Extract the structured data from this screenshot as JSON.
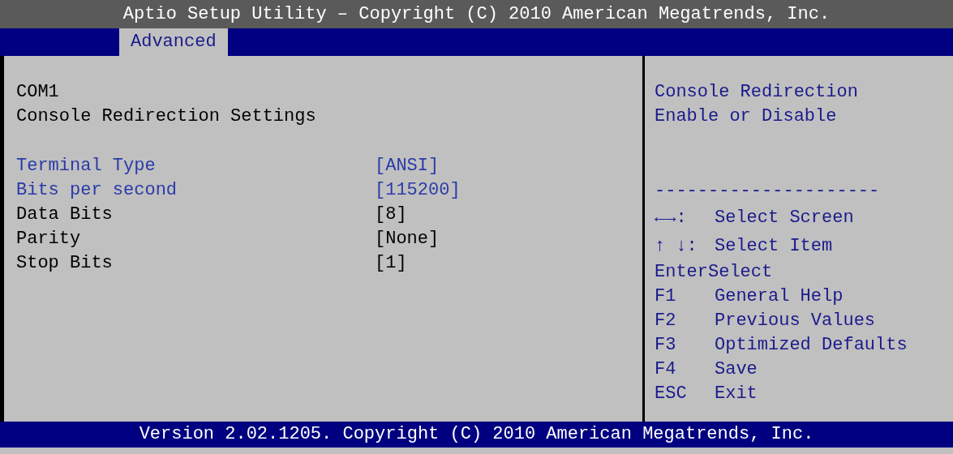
{
  "title_bar": "Aptio Setup Utility – Copyright (C) 2010 American Megatrends, Inc.",
  "tabs": [
    {
      "label": "Advanced",
      "selected": true
    }
  ],
  "headings": [
    "COM1",
    "Console Redirection Settings"
  ],
  "settings": [
    {
      "label": "Terminal Type",
      "value": "[ANSI]",
      "disabled": false
    },
    {
      "label": "Bits per second",
      "value": "[115200]",
      "disabled": false
    },
    {
      "label": "Data Bits",
      "value": "[8]",
      "disabled": true
    },
    {
      "label": "Parity",
      "value": "[None]",
      "disabled": true
    },
    {
      "label": "Stop Bits",
      "value": "[1]",
      "disabled": true
    }
  ],
  "help_text": [
    "Console Redirection",
    "Enable or Disable"
  ],
  "separator": "---------------------",
  "key_legend": [
    {
      "key": "←→:",
      "action": "Select Screen"
    },
    {
      "key": "↑ ↓:",
      "action": "Select Item"
    },
    {
      "key": "Enter",
      "action": "Select"
    },
    {
      "key": "F1",
      "action": "General Help"
    },
    {
      "key": "F2",
      "action": "Previous Values"
    },
    {
      "key": "F3",
      "action": "Optimized Defaults"
    },
    {
      "key": "F4",
      "action": "Save"
    },
    {
      "key": "ESC",
      "action": "Exit"
    }
  ],
  "footer": "Version 2.02.1205. Copyright (C) 2010 American Megatrends, Inc."
}
